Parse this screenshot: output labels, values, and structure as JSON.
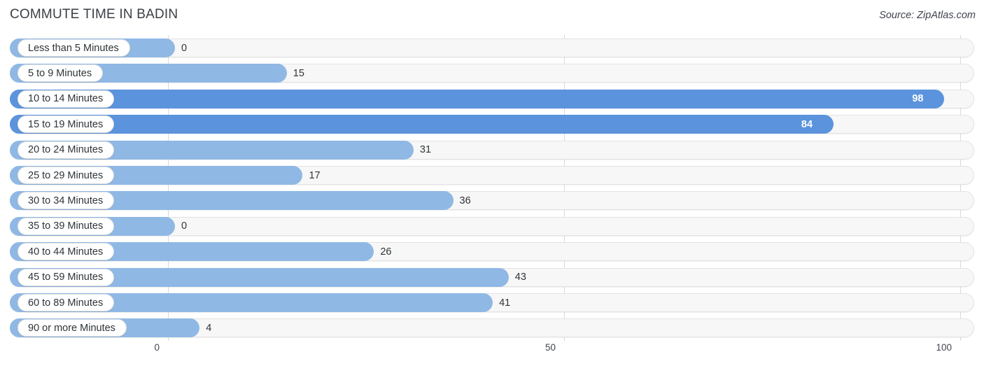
{
  "header": {
    "title": "COMMUTE TIME IN BADIN",
    "source": "Source: ZipAtlas.com"
  },
  "axis": {
    "ticks": [
      "0",
      "50",
      "100"
    ],
    "tick_values": [
      0,
      50,
      100
    ]
  },
  "colors": {
    "bar_light": "#8fb8e4",
    "bar_dark": "#5b93dd",
    "track": "#f7f7f7",
    "track_border": "#e3e3e3",
    "gridline": "#d9d9d9",
    "text": "#2f3438",
    "title": "#3a3f45"
  },
  "chart_data": {
    "type": "bar",
    "orientation": "horizontal",
    "title": "COMMUTE TIME IN BADIN",
    "subtitle": "Source: ZipAtlas.com",
    "xlabel": "",
    "ylabel": "",
    "xlim": [
      0,
      100
    ],
    "grid": true,
    "legend": "none",
    "xticks": [
      0,
      50,
      100
    ],
    "categories": [
      "Less than 5 Minutes",
      "5 to 9 Minutes",
      "10 to 14 Minutes",
      "15 to 19 Minutes",
      "20 to 24 Minutes",
      "25 to 29 Minutes",
      "30 to 34 Minutes",
      "35 to 39 Minutes",
      "40 to 44 Minutes",
      "45 to 59 Minutes",
      "60 to 89 Minutes",
      "90 or more Minutes"
    ],
    "values": [
      0,
      15,
      98,
      84,
      31,
      17,
      36,
      0,
      26,
      43,
      41,
      4
    ],
    "value_labels": [
      "0",
      "15",
      "98",
      "84",
      "31",
      "17",
      "36",
      "0",
      "26",
      "43",
      "41",
      "4"
    ],
    "bars": [
      {
        "label": "Less than 5 Minutes",
        "value": 0,
        "value_label": "0",
        "highlight": false,
        "label_inside": false
      },
      {
        "label": "5 to 9 Minutes",
        "value": 15,
        "value_label": "15",
        "highlight": false,
        "label_inside": false
      },
      {
        "label": "10 to 14 Minutes",
        "value": 98,
        "value_label": "98",
        "highlight": true,
        "label_inside": true
      },
      {
        "label": "15 to 19 Minutes",
        "value": 84,
        "value_label": "84",
        "highlight": true,
        "label_inside": true
      },
      {
        "label": "20 to 24 Minutes",
        "value": 31,
        "value_label": "31",
        "highlight": false,
        "label_inside": false
      },
      {
        "label": "25 to 29 Minutes",
        "value": 17,
        "value_label": "17",
        "highlight": false,
        "label_inside": false
      },
      {
        "label": "30 to 34 Minutes",
        "value": 36,
        "value_label": "36",
        "highlight": false,
        "label_inside": false
      },
      {
        "label": "35 to 39 Minutes",
        "value": 0,
        "value_label": "0",
        "highlight": false,
        "label_inside": false
      },
      {
        "label": "40 to 44 Minutes",
        "value": 26,
        "value_label": "26",
        "highlight": false,
        "label_inside": false
      },
      {
        "label": "45 to 59 Minutes",
        "value": 43,
        "value_label": "43",
        "highlight": false,
        "label_inside": false
      },
      {
        "label": "60 to 89 Minutes",
        "value": 41,
        "value_label": "41",
        "highlight": false,
        "label_inside": false
      },
      {
        "label": "90 or more Minutes",
        "value": 4,
        "value_label": "4",
        "highlight": false,
        "label_inside": false
      }
    ]
  }
}
